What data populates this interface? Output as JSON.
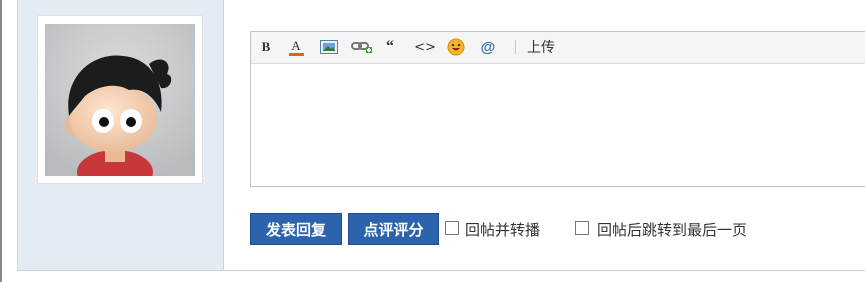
{
  "user": {
    "avatar_icon": "cartoon-boy-avatar"
  },
  "toolbar": {
    "bold": "B",
    "color": "A",
    "color_accent": "#f0572b",
    "quote": "“",
    "code": "<>",
    "at": "@",
    "upload": "上传",
    "icons": [
      "bold-icon",
      "font-color-icon",
      "image-icon",
      "link-icon",
      "quote-icon",
      "code-icon",
      "emoji-icon",
      "mention-icon"
    ]
  },
  "editor": {
    "value": ""
  },
  "actions": {
    "reply_label": "发表回复",
    "rate_label": "点评评分",
    "button_color": "#2c63ad"
  },
  "options": [
    {
      "label": "回帖并转播",
      "checked": false
    },
    {
      "label": "回帖后跳转到最后一页",
      "checked": false
    }
  ]
}
